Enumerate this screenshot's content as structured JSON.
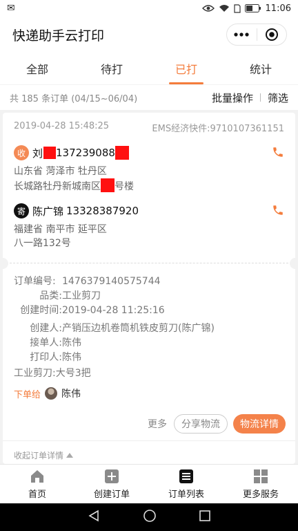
{
  "status_bar": {
    "time": "11:06"
  },
  "title_bar": {
    "title": "快递助手云打印"
  },
  "tabs": [
    {
      "label": "全部"
    },
    {
      "label": "待打"
    },
    {
      "label": "已打"
    },
    {
      "label": "统计"
    }
  ],
  "summary": {
    "text": "共 185 条订单 (04/15~06/04)",
    "batch_label": "批量操作",
    "filter_label": "筛选"
  },
  "order": {
    "datetime": "2019-04-28 15:48:25",
    "courier": "EMS经济快件:9710107361151",
    "receiver": {
      "badge": "收",
      "name": "刘",
      "phone": "137239088",
      "addr_line1": "山东省 菏泽市 牡丹区",
      "addr_line2": "长城路牡丹新城南区",
      "addr_line2_tail": "号楼"
    },
    "sender": {
      "badge": "寄",
      "name": "陈广锦",
      "phone": "13328387920",
      "addr_line1": "福建省 南平市 延平区",
      "addr_line2": "八一路132号"
    },
    "details": {
      "order_no_label": "订单编号:",
      "order_no": "1476379140575744",
      "category_label": "品类:",
      "category": "工业剪刀",
      "created_label": "创建时间:",
      "created": "2019-04-28 11:25:16",
      "creator_label": "创建人:",
      "creator": "产销压边机卷筒机铁皮剪刀(陈广锦)",
      "taker_label": "接单人:",
      "taker": "陈伟",
      "printer_label": "打印人:",
      "printer": "陈伟",
      "product": "工业剪刀:大号3把"
    },
    "assign_label": "下单给",
    "assign_to": "陈伟",
    "more_label": "更多",
    "share_label": "分享物流",
    "logistics_label": "物流详情",
    "collapse_label": "收起订单详情"
  },
  "bottom_nav": [
    {
      "label": "首页",
      "icon": "home-icon"
    },
    {
      "label": "创建订单",
      "icon": "plus-square-icon"
    },
    {
      "label": "订单列表",
      "icon": "list-icon"
    },
    {
      "label": "更多服务",
      "icon": "grid-icon"
    }
  ],
  "colors": {
    "accent": "#f47c3c",
    "button_fill": "#f4824a",
    "redaction": "#ff1010"
  }
}
